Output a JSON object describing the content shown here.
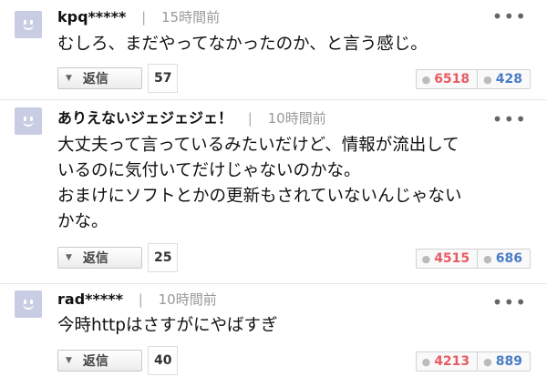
{
  "comments": [
    {
      "user": "kpq*****",
      "time": "15時間前",
      "text_lines": [
        "むしろ、まだやってなかったのか、と言う感じ。"
      ],
      "reply_label": "返信",
      "reply_count": "57",
      "likes": "6518",
      "dislikes": "428"
    },
    {
      "user": "ありえないジェジェジェ！",
      "time": "10時間前",
      "text_lines": [
        "大丈夫って言っているみたいだけど、情報が流出して",
        "いるのに気付いてだけじゃないのかな。",
        "おまけにソフトとかの更新もされていないんじゃない",
        "かな。"
      ],
      "reply_label": "返信",
      "reply_count": "25",
      "likes": "4515",
      "dislikes": "686"
    },
    {
      "user": "rad*****",
      "time": "10時間前",
      "text_lines": [
        "今時httpはさすがにやばすぎ"
      ],
      "reply_label": "返信",
      "reply_count": "40",
      "likes": "4213",
      "dislikes": "889"
    }
  ],
  "separator": "|",
  "more_glyph": "•••",
  "icons": {
    "avatar": "default-face-avatar",
    "reply_toggle": "triangle-down-icon",
    "like": "thumbs-up-icon",
    "dislike": "thumbs-down-icon",
    "more": "more-dots-icon"
  },
  "colors": {
    "like": "#e95b64",
    "dislike": "#4a7cc6",
    "avatar": "#c9cde3"
  }
}
